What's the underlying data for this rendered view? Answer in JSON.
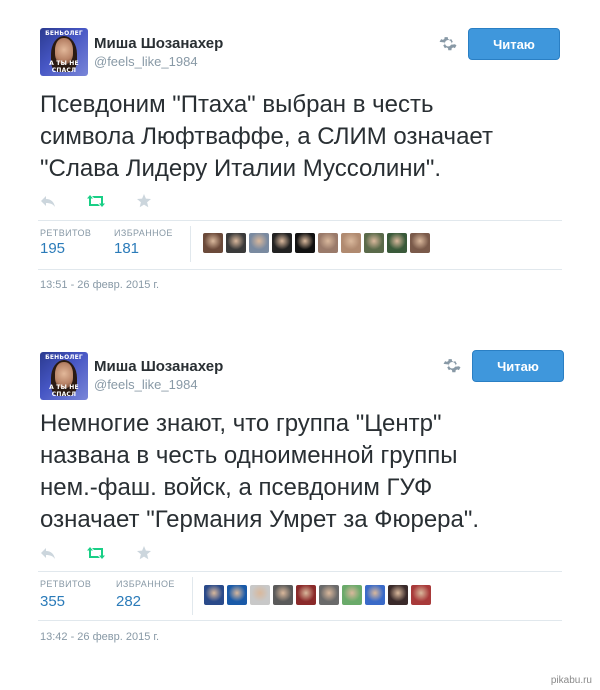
{
  "tweets": [
    {
      "user": {
        "name": "Миша Шозанахер",
        "handle": "@feels_like_1984",
        "avatar_caption_top": "БЕНЬОЛЕГ",
        "avatar_caption_bottom": "А ТЫ НЕ СПАСЛ"
      },
      "follow_label": "Читаю",
      "text": "Псевдоним \"Птаха\" выбран в честь\nсимвола Люфтваффе, а СЛИМ означает\n\"Слава Лидеру Италии Муссолини\".",
      "actions": [
        "reply-icon",
        "retweet-icon",
        "favorite-icon"
      ],
      "stats": {
        "retweets_label": "РЕТВИТОВ",
        "retweets": "195",
        "favorites_label": "ИЗБРАННОЕ",
        "favorites": "181"
      },
      "favoriters": [
        "#6b4a3a",
        "#3a3a3a",
        "#7a8aa0",
        "#222222",
        "#111111",
        "#9a7a6a",
        "#b08a70",
        "#5a6a4a",
        "#3a5a3a",
        "#7a5a4a"
      ],
      "timestamp": "13:51 - 26 февр. 2015 г."
    },
    {
      "user": {
        "name": "Миша Шозанахер",
        "handle": "@feels_like_1984",
        "avatar_caption_top": "БЕНЬОЛЕГ",
        "avatar_caption_bottom": "А ТЫ НЕ СПАСЛ"
      },
      "follow_label": "Читаю",
      "text": "Немногие знают, что группа \"Центр\"\nназвана в честь одноименной группы\nнем.-фаш. войск, а псевдоним ГУФ\nозначает \"Германия Умрет за Фюрера\".",
      "actions": [
        "reply-icon",
        "retweet-icon",
        "favorite-icon"
      ],
      "stats": {
        "retweets_label": "РЕТВИТОВ",
        "retweets": "355",
        "favorites_label": "ИЗБРАННОЕ",
        "favorites": "282"
      },
      "favoriters": [
        "#2a4a8a",
        "#1a5aa8",
        "#c8c8c8",
        "#5a5a5a",
        "#8a2a2a",
        "#6a6a6a",
        "#6aaa6a",
        "#3a6ac8",
        "#3a2a2a",
        "#a83a3a"
      ],
      "timestamp": "13:42 - 26 февр. 2015 г."
    }
  ],
  "watermark": "pikabu.ru",
  "colors": {
    "accent": "#2b7bb9",
    "button": "#3f97dc",
    "retweeted": "#19cf86",
    "muted": "#8899a6",
    "text": "#292f33"
  }
}
